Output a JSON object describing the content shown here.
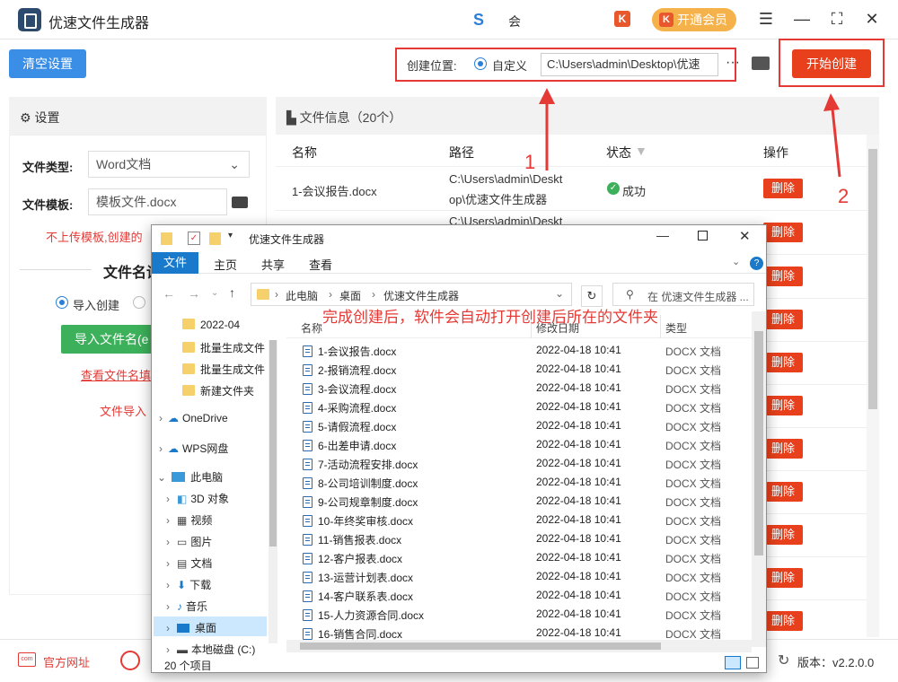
{
  "app": {
    "title": "优速文件生成器",
    "user": "会"
  },
  "header": {
    "vip_label": "开通会员",
    "k_badge": "K"
  },
  "toolbar": {
    "clear_label": "清空设置",
    "location_label": "创建位置:",
    "custom_label": "自定义",
    "path_value": "C:\\Users\\admin\\Desktop\\优速",
    "more_label": "···",
    "start_label": "开始创建"
  },
  "annotations": {
    "num1": "1",
    "num2": "2",
    "note": "完成创建后，软件会自动打开创建后所在的文件夹"
  },
  "settings": {
    "title": "设置",
    "file_type_label": "文件类型:",
    "file_type_value": "Word文档",
    "template_label": "文件模板:",
    "template_value": "模板文件.docx",
    "template_hint": "不上传模板,创建的",
    "name_section": "文件名设",
    "import_create": "导入创建",
    "import_button": "导入文件名(e",
    "view_link": "查看文件名填",
    "import_hint": "文件导入"
  },
  "file_info": {
    "title": "文件信息（20个）",
    "columns": [
      "名称",
      "路径",
      "状态",
      "操作"
    ],
    "rows": [
      {
        "name": "1-会议报告.docx",
        "path1": "C:\\Users\\admin\\Deskt",
        "path2": "op\\优速文件生成器",
        "status": "成功",
        "action": "删除"
      },
      {
        "path1": "C:\\Users\\admin\\Deskt",
        "action": "删除"
      }
    ],
    "delete_label": "删除"
  },
  "bottom": {
    "site_label": "官方网址",
    "version": "版本：v2.2.0.0"
  },
  "explorer": {
    "title": "优速文件生成器",
    "tabs": [
      "文件",
      "主页",
      "共享",
      "查看"
    ],
    "breadcrumb": [
      "此电脑",
      "桌面",
      "优速文件生成器"
    ],
    "search_placeholder": "在 优速文件生成器 ...",
    "columns": [
      "名称",
      "修改日期",
      "类型"
    ],
    "nav": [
      "2022-04",
      "批量生成文件",
      "批量生成文件",
      "新建文件夹",
      "OneDrive",
      "WPS网盘",
      "此电脑",
      "3D 对象",
      "视频",
      "图片",
      "文档",
      "下载",
      "音乐",
      "桌面",
      "本地磁盘 (C:)"
    ],
    "files": [
      {
        "name": "1-会议报告.docx",
        "date": "2022-04-18 10:41",
        "type": "DOCX 文档"
      },
      {
        "name": "2-报销流程.docx",
        "date": "2022-04-18 10:41",
        "type": "DOCX 文档"
      },
      {
        "name": "3-会议流程.docx",
        "date": "2022-04-18 10:41",
        "type": "DOCX 文档"
      },
      {
        "name": "4-采购流程.docx",
        "date": "2022-04-18 10:41",
        "type": "DOCX 文档"
      },
      {
        "name": "5-请假流程.docx",
        "date": "2022-04-18 10:41",
        "type": "DOCX 文档"
      },
      {
        "name": "6-出差申请.docx",
        "date": "2022-04-18 10:41",
        "type": "DOCX 文档"
      },
      {
        "name": "7-活动流程安排.docx",
        "date": "2022-04-18 10:41",
        "type": "DOCX 文档"
      },
      {
        "name": "8-公司培训制度.docx",
        "date": "2022-04-18 10:41",
        "type": "DOCX 文档"
      },
      {
        "name": "9-公司规章制度.docx",
        "date": "2022-04-18 10:41",
        "type": "DOCX 文档"
      },
      {
        "name": "10-年终奖审核.docx",
        "date": "2022-04-18 10:41",
        "type": "DOCX 文档"
      },
      {
        "name": "11-销售报表.docx",
        "date": "2022-04-18 10:41",
        "type": "DOCX 文档"
      },
      {
        "name": "12-客户报表.docx",
        "date": "2022-04-18 10:41",
        "type": "DOCX 文档"
      },
      {
        "name": "13-运营计划表.docx",
        "date": "2022-04-18 10:41",
        "type": "DOCX 文档"
      },
      {
        "name": "14-客户联系表.docx",
        "date": "2022-04-18 10:41",
        "type": "DOCX 文档"
      },
      {
        "name": "15-人力资源合同.docx",
        "date": "2022-04-18 10:41",
        "type": "DOCX 文档"
      },
      {
        "name": "16-销售合同.docx",
        "date": "2022-04-18 10:41",
        "type": "DOCX 文档"
      }
    ],
    "status": "20 个项目"
  }
}
